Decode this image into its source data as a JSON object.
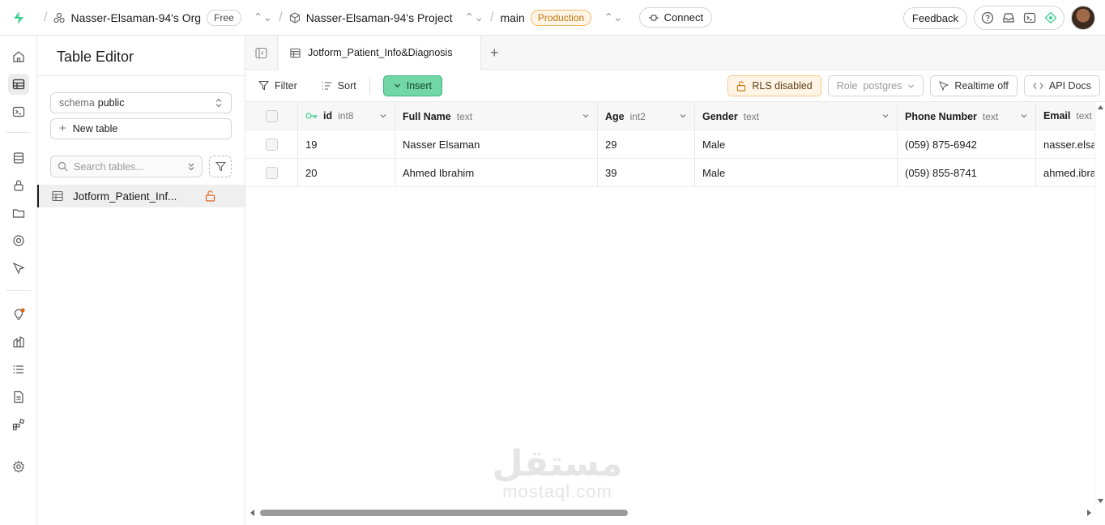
{
  "topbar": {
    "org": "Nasser-Elsaman-94's Org",
    "plan": "Free",
    "project": "Nasser-Elsaman-94's Project",
    "branch": "main",
    "environment": "Production",
    "connect": "Connect",
    "feedback": "Feedback"
  },
  "sidebar": {
    "title": "Table Editor",
    "schema_label": "schema",
    "schema_value": "public",
    "new_table": "New table",
    "search_placeholder": "Search tables...",
    "tables": [
      {
        "label": "Jotform_Patient_Inf..."
      }
    ]
  },
  "main": {
    "tab": "Jotform_Patient_Info&Diagnosis",
    "toolbar": {
      "filter": "Filter",
      "sort": "Sort",
      "insert": "Insert",
      "rls": "RLS disabled",
      "role_label": "Role",
      "role_value": "postgres",
      "realtime": "Realtime off",
      "api_docs": "API Docs"
    },
    "columns": [
      {
        "name": "id",
        "type": "int8"
      },
      {
        "name": "Full Name",
        "type": "text"
      },
      {
        "name": "Age",
        "type": "int2"
      },
      {
        "name": "Gender",
        "type": "text"
      },
      {
        "name": "Phone Number",
        "type": "text"
      },
      {
        "name": "Email",
        "type": "text"
      }
    ],
    "rows": [
      {
        "id": "19",
        "full_name": "Nasser Elsaman",
        "age": "29",
        "gender": "Male",
        "phone": "(059) 875-6942",
        "email": "nasser.elsa"
      },
      {
        "id": "20",
        "full_name": "Ahmed Ibrahim",
        "age": "39",
        "gender": "Male",
        "phone": "(059) 855-8741",
        "email": "ahmed.ibra"
      }
    ]
  },
  "watermark": {
    "arabic": "مستقل",
    "latin": "mostaql.com"
  },
  "colors": {
    "brand": "#3ecf8e",
    "insert_bg": "#72d6a5",
    "production": "#c2740c",
    "rls_bg": "#fff4e5"
  },
  "icons": [
    "supabase-logo-icon",
    "org-icon",
    "project-icon",
    "connect-icon",
    "help-icon",
    "inbox-icon",
    "terminal-icon",
    "assistant-icon",
    "home-icon",
    "table-editor-icon",
    "sql-editor-icon",
    "database-icon",
    "auth-icon",
    "storage-icon",
    "realtime-icon",
    "edge-functions-icon",
    "advisors-icon",
    "reports-icon",
    "logs-icon",
    "docs-icon",
    "integrations-icon",
    "settings-icon",
    "lock-open-icon",
    "key-icon"
  ]
}
